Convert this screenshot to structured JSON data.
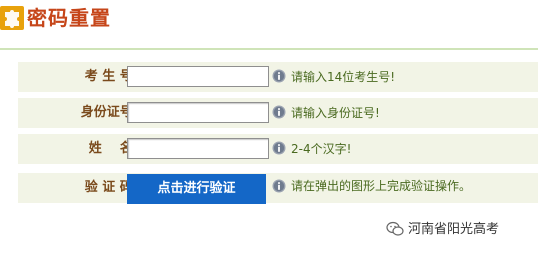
{
  "header": {
    "logo_icon": "puzzle-icon",
    "title": "密码重置"
  },
  "form": {
    "rows": [
      {
        "label": "考 生 号:",
        "input_value": "",
        "hint_icon": "info-icon",
        "hint": "请输入14位考生号!"
      },
      {
        "label": "身份证号:",
        "input_value": "",
        "hint_icon": "info-icon",
        "hint": "请输入身份证号!"
      },
      {
        "label": "姓    名:",
        "input_value": "",
        "hint_icon": "info-icon",
        "hint": "2-4个汉字!"
      },
      {
        "label": "验 证 码:",
        "button_label": "点击进行验证",
        "hint_icon": "info-icon",
        "hint": "请在弹出的图形上完成验证操作。"
      }
    ]
  },
  "watermark": {
    "icon": "wechat-icon",
    "text": "河南省阳光高考"
  },
  "colors": {
    "title": "#c6461a",
    "label": "#7a4a1c",
    "row_background": "#f2f4e6",
    "button": "#1467c7",
    "accent_logo": "#e8a20c"
  }
}
